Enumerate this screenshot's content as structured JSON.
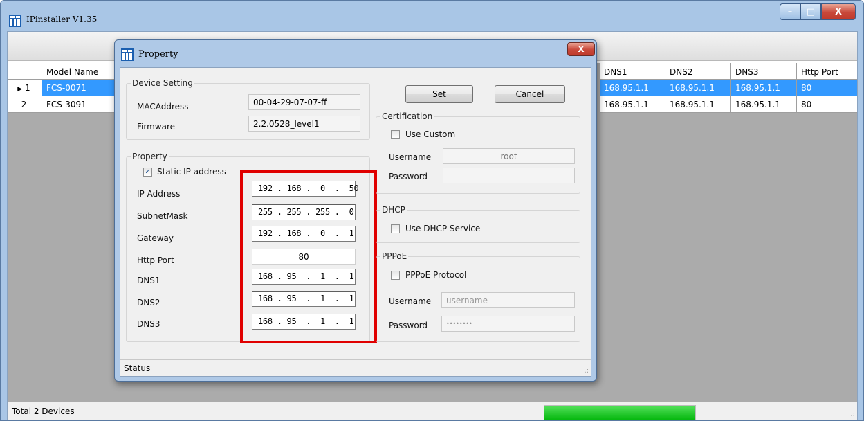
{
  "app": {
    "title": "IPinstaller V1.35"
  },
  "window_buttons": {
    "minimize": "–",
    "maximize": "□",
    "close": "X"
  },
  "grid": {
    "visible_headers": {
      "model_name": "Model Name",
      "dns1": "DNS1",
      "dns2": "DNS2",
      "dns3": "DNS3",
      "http_port": "Http Port"
    },
    "rows": [
      {
        "num": "1",
        "model": "FCS-0071",
        "dns1": "168.95.1.1",
        "dns2": "168.95.1.1",
        "dns3": "168.95.1.1",
        "http_port": "80",
        "selected": true
      },
      {
        "num": "2",
        "model": "FCS-3091",
        "dns1": "168.95.1.1",
        "dns2": "168.95.1.1",
        "dns3": "168.95.1.1",
        "http_port": "80",
        "selected": false
      }
    ],
    "row_marker": "▶"
  },
  "status": {
    "text": "Total 2 Devices",
    "progress": 1.0
  },
  "dialog": {
    "title": "Property",
    "close": "X",
    "device_setting": {
      "legend": "Device Setting",
      "mac_label": "MACAddress",
      "mac_value": "00-04-29-07-07-ff",
      "firmware_label": "Firmware",
      "firmware_value": "2.2.0528_level1"
    },
    "property": {
      "legend": "Property",
      "static_ip_label": "Static IP address",
      "static_ip_checked": true,
      "check_mark": "✓",
      "ip_label": "IP Address",
      "ip_value": "192 . 168 .  0  .  50",
      "subnet_label": "SubnetMask",
      "subnet_value": "255 . 255 . 255 .  0",
      "gateway_label": "Gateway",
      "gateway_value": "192 . 168 .  0  .  1",
      "http_label": "Http Port",
      "http_value": "80",
      "dns1_label": "DNS1",
      "dns1_value": "168 . 95  .  1  .  1",
      "dns2_label": "DNS2",
      "dns2_value": "168 . 95  .  1  .  1",
      "dns3_label": "DNS3",
      "dns3_value": "168 . 95  .  1  .  1"
    },
    "buttons": {
      "set": "Set",
      "cancel": "Cancel"
    },
    "certification": {
      "legend": "Certification",
      "use_custom_label": "Use Custom",
      "username_label": "Username",
      "username_value": "root",
      "password_label": "Password",
      "password_value": ""
    },
    "dhcp": {
      "legend": "DHCP",
      "use_dhcp_label": "Use DHCP Service"
    },
    "pppoe": {
      "legend": "PPPoE",
      "protocol_label": "PPPoE Protocol",
      "username_label": "Username",
      "username_value": "username",
      "password_label": "Password",
      "password_value": "••••••••"
    },
    "status_label": "Status"
  },
  "colors": {
    "selection": "#3399ff",
    "highlight_border": "#e00000",
    "progress": "#06b80f"
  }
}
